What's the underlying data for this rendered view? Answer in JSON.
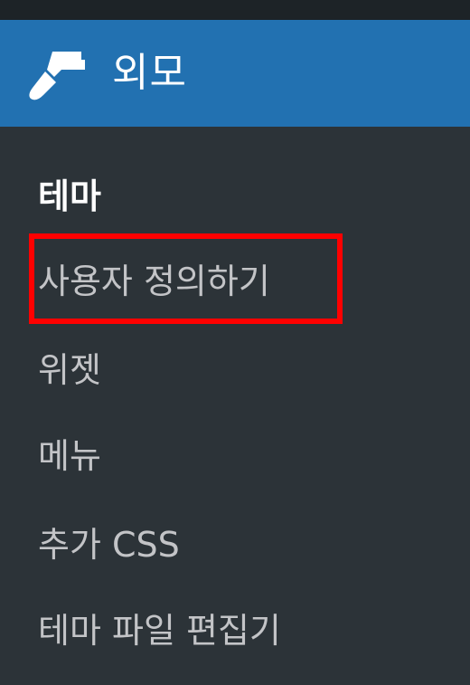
{
  "menu": {
    "title": "외모",
    "icon": "paintbrush-icon"
  },
  "submenu": {
    "items": [
      {
        "label": "테마",
        "current": true
      },
      {
        "label": "사용자 정의하기",
        "highlighted": true
      },
      {
        "label": "위젯"
      },
      {
        "label": "메뉴"
      },
      {
        "label": "추가 CSS"
      },
      {
        "label": "테마 파일 편집기"
      }
    ]
  },
  "colors": {
    "header_bg": "#2271b1",
    "menu_bg": "#2c3338",
    "top_bg": "#1d2327",
    "highlight": "#ff0000",
    "text": "#c3c4c7",
    "text_current": "#ffffff"
  }
}
